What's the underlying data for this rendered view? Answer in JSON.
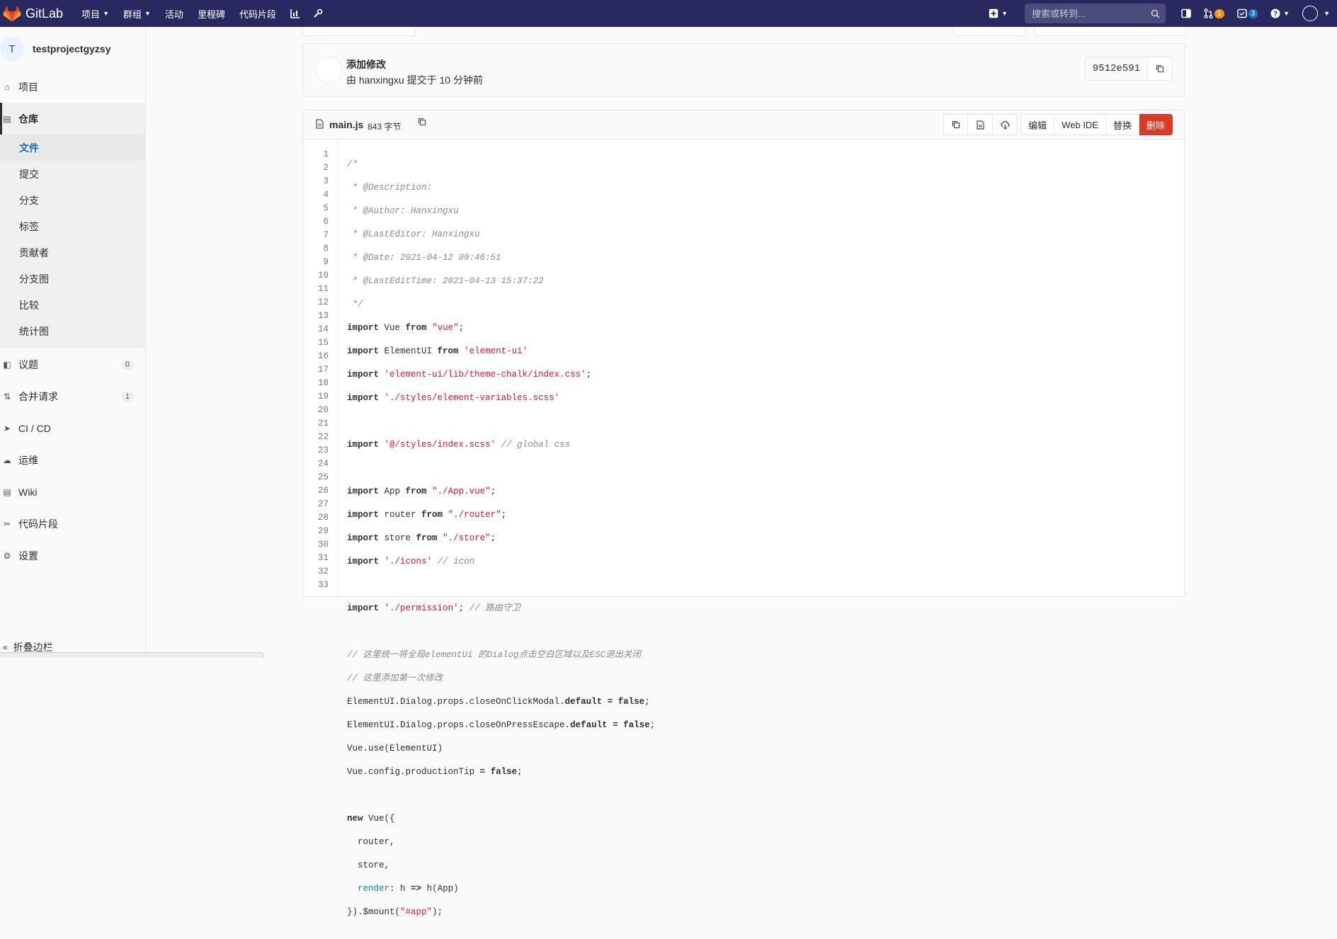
{
  "nav": {
    "brand": "GitLab",
    "links": [
      "项目",
      "群组",
      "活动",
      "里程碑",
      "代码片段"
    ],
    "search_placeholder": "搜索或转到...",
    "mr_count": "1",
    "todo_count": "3"
  },
  "sidebar": {
    "project_initial": "T",
    "project_name": "testprojectgyzsy",
    "project_label": "项目",
    "repo_label": "仓库",
    "repo_sub": [
      "文件",
      "提交",
      "分支",
      "标签",
      "贡献者",
      "分支图",
      "比较",
      "统计图"
    ],
    "issues_label": "议题",
    "issues_count": "0",
    "mr_label": "合并请求",
    "mr_count": "1",
    "cicd_label": "CI / CD",
    "ops_label": "运维",
    "wiki_label": "Wiki",
    "snippets_label": "代码片段",
    "settings_label": "设置",
    "collapse_label": "折叠边栏"
  },
  "commit": {
    "title": "添加修改",
    "meta": "由 hanxingxu 提交于 10 分钟前",
    "sha": "9512e591"
  },
  "file": {
    "name": "main.js",
    "size": "843 字节",
    "buttons": {
      "edit": "编辑",
      "webide": "Web IDE",
      "replace": "替换",
      "delete": "删除"
    }
  }
}
